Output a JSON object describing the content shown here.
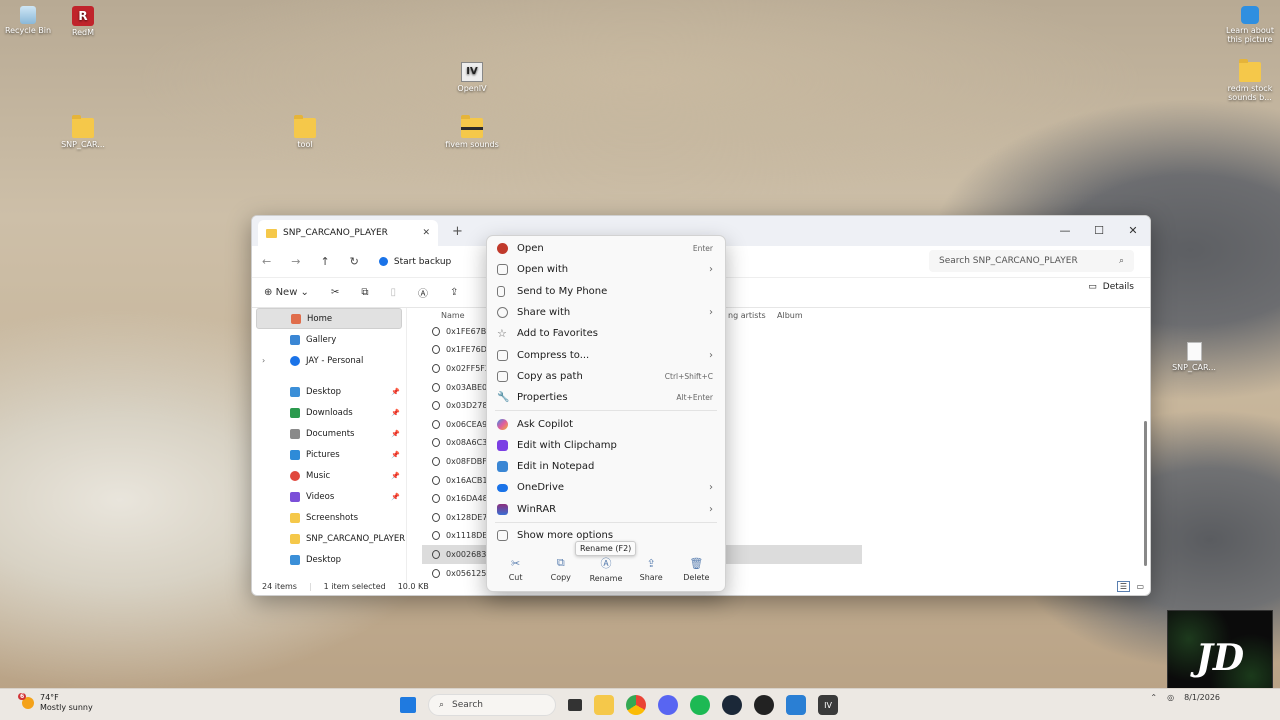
{
  "desktop": {
    "icons": [
      {
        "label": "Recycle Bin"
      },
      {
        "label": "RedM"
      },
      {
        "label": "OpenIV"
      },
      {
        "label": "SNP_CAR..."
      },
      {
        "label": "tool"
      },
      {
        "label": "fivem sounds"
      },
      {
        "label": "Learn about this picture"
      },
      {
        "label": "redm stock sounds b..."
      },
      {
        "label": "SNP_CAR..."
      }
    ]
  },
  "window": {
    "tab_title": "SNP_CARCANO_PLAYER",
    "address_prefix": "Start backup",
    "search_placeholder": "Search SNP_CARCANO_PLAYER",
    "new_label": "New",
    "details_label": "Details",
    "columns": {
      "name": "Name",
      "contributing": "ng artists",
      "album": "Album"
    },
    "sidebar": [
      {
        "label": "Home",
        "icon": "home-icon",
        "color": "#e06d4b"
      },
      {
        "label": "Gallery",
        "icon": "gallery-icon",
        "color": "#3a86d4"
      },
      {
        "label": "JAY - Personal",
        "icon": "onedrive-icon",
        "color": "#1a73e8"
      },
      {
        "label": "Desktop",
        "icon": "desktop-icon",
        "color": "#3b8fd8"
      },
      {
        "label": "Downloads",
        "icon": "download-icon",
        "color": "#2b9a4e"
      },
      {
        "label": "Documents",
        "icon": "document-icon",
        "color": "#8a8a8a"
      },
      {
        "label": "Pictures",
        "icon": "pictures-icon",
        "color": "#2e8bd8"
      },
      {
        "label": "Music",
        "icon": "music-icon",
        "color": "#e0483d"
      },
      {
        "label": "Videos",
        "icon": "videos-icon",
        "color": "#7b4fd8"
      },
      {
        "label": "Screenshots",
        "icon": "folder-icon",
        "color": "#f5c84a"
      },
      {
        "label": "SNP_CARCANO_PLAYER",
        "icon": "folder-icon",
        "color": "#f5c84a"
      },
      {
        "label": "Desktop",
        "icon": "desktop-icon",
        "color": "#3b8fd8"
      }
    ],
    "files": [
      "0x1FE67BB",
      "0x1FE76D1",
      "0x02FF5F2",
      "0x03ABE07",
      "0x03D2786",
      "0x06CEA9",
      "0x08A6C3",
      "0x08FDBF4",
      "0x16ACB1",
      "0x16DA484",
      "0x128DE72",
      "0x1118DE1",
      "0x002683E",
      "0x0561255"
    ],
    "status": {
      "count": "24 items",
      "selected": "1 item selected",
      "size": "10.0 KB"
    }
  },
  "context_menu": {
    "items": [
      {
        "label": "Open",
        "shortcut": "Enter",
        "icon": "open-icon",
        "color": "#c0392b"
      },
      {
        "label": "Open with",
        "submenu": true,
        "icon": "open-with-icon",
        "color": "#777777"
      },
      {
        "label": "Send to My Phone",
        "icon": "phone-icon",
        "color": "#777777"
      },
      {
        "label": "Share with",
        "submenu": true,
        "icon": "share-icon",
        "color": "#777777"
      },
      {
        "label": "Add to Favorites",
        "icon": "star-icon",
        "color": "#777777"
      },
      {
        "label": "Compress to...",
        "submenu": true,
        "icon": "zip-icon",
        "color": "#777777"
      },
      {
        "label": "Copy as path",
        "shortcut": "Ctrl+Shift+C",
        "icon": "path-icon",
        "color": "#777777"
      },
      {
        "label": "Properties",
        "shortcut": "Alt+Enter",
        "icon": "wrench-icon",
        "color": "#777777"
      }
    ],
    "items2": [
      {
        "label": "Ask Copilot",
        "icon": "copilot-icon",
        "color": "#e05d9f"
      },
      {
        "label": "Edit with Clipchamp",
        "icon": "clipchamp-icon",
        "color": "#7b3fe4"
      },
      {
        "label": "Edit in Notepad",
        "icon": "notepad-icon",
        "color": "#3a86d4"
      },
      {
        "label": "OneDrive",
        "submenu": true,
        "icon": "onedrive-icon",
        "color": "#1a73e8"
      },
      {
        "label": "WinRAR",
        "submenu": true,
        "icon": "winrar-icon",
        "color": "#8b2f7d"
      }
    ],
    "more": "Show more options",
    "quick": [
      {
        "label": "Cut",
        "icon": "scissors-icon"
      },
      {
        "label": "Copy",
        "icon": "copy-icon"
      },
      {
        "label": "Rename",
        "icon": "rename-icon"
      },
      {
        "label": "Share",
        "icon": "share-icon"
      },
      {
        "label": "Delete",
        "icon": "trash-icon"
      }
    ],
    "tooltip": "Rename (F2)"
  },
  "taskbar": {
    "temp": "74°F",
    "weather": "Mostly sunny",
    "weather_badge": "6",
    "search_label": "Search",
    "date": "8/1/2026"
  },
  "logo_text": "JD"
}
